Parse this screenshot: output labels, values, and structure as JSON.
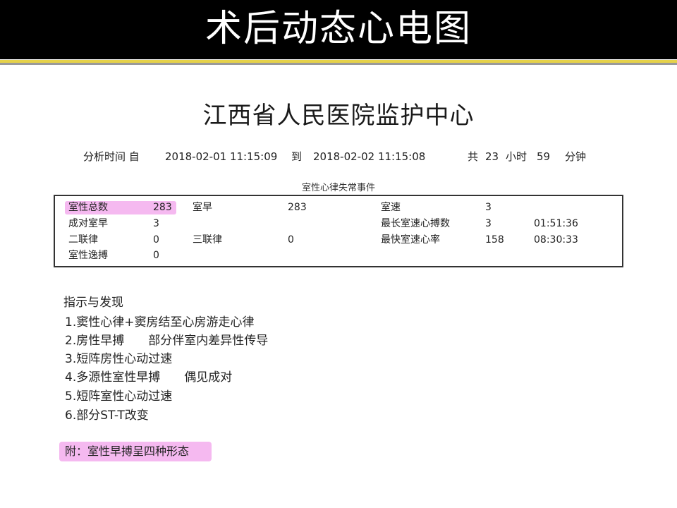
{
  "slide": {
    "title": "术后动态心电图"
  },
  "report": {
    "hospital": "江西省人民医院监护中心",
    "period": {
      "from_label": "分析时间 自",
      "from": "2018-02-01 11:15:09",
      "to_label": "到",
      "to": "2018-02-02 11:15:08",
      "total_label": "共",
      "hours": "23",
      "hours_unit": "小时",
      "minutes": "59",
      "minutes_unit": "分钟"
    },
    "section_title": "室性心律失常事件",
    "events": {
      "total_label": "室性总数",
      "total_value": "283",
      "pairs_label": "成对室早",
      "pairs_value": "3",
      "bigeminy_label": "二联律",
      "bigeminy_value": "0",
      "escape_label": "室性逸搏",
      "escape_value": "0",
      "pvc_label": "室早",
      "pvc_value": "283",
      "trigeminy_label": "三联律",
      "trigeminy_value": "0",
      "vt_label": "室速",
      "vt_value": "3",
      "longest_vt_label": "最长室速心搏数",
      "longest_vt_value": "3",
      "longest_vt_time": "01:51:36",
      "fastest_vt_label": "最快室速心率",
      "fastest_vt_value": "158",
      "fastest_vt_time": "08:30:33"
    },
    "findings_title": "指示与发现",
    "findings": [
      "1.窦性心律+窦房结至心房游走心律",
      "2.房性早搏　　部分伴室内差异性传导",
      "3.短阵房性心动过速",
      "4.多源性室性早搏　　偶见成对",
      "5.短阵室性心动过速",
      "6.部分ST-T改变"
    ],
    "note": "附：室性早搏呈四种形态"
  },
  "colors": {
    "title_bar": "#000000",
    "accent_line": "#e6d24a",
    "highlight": "#f5b9f0"
  }
}
